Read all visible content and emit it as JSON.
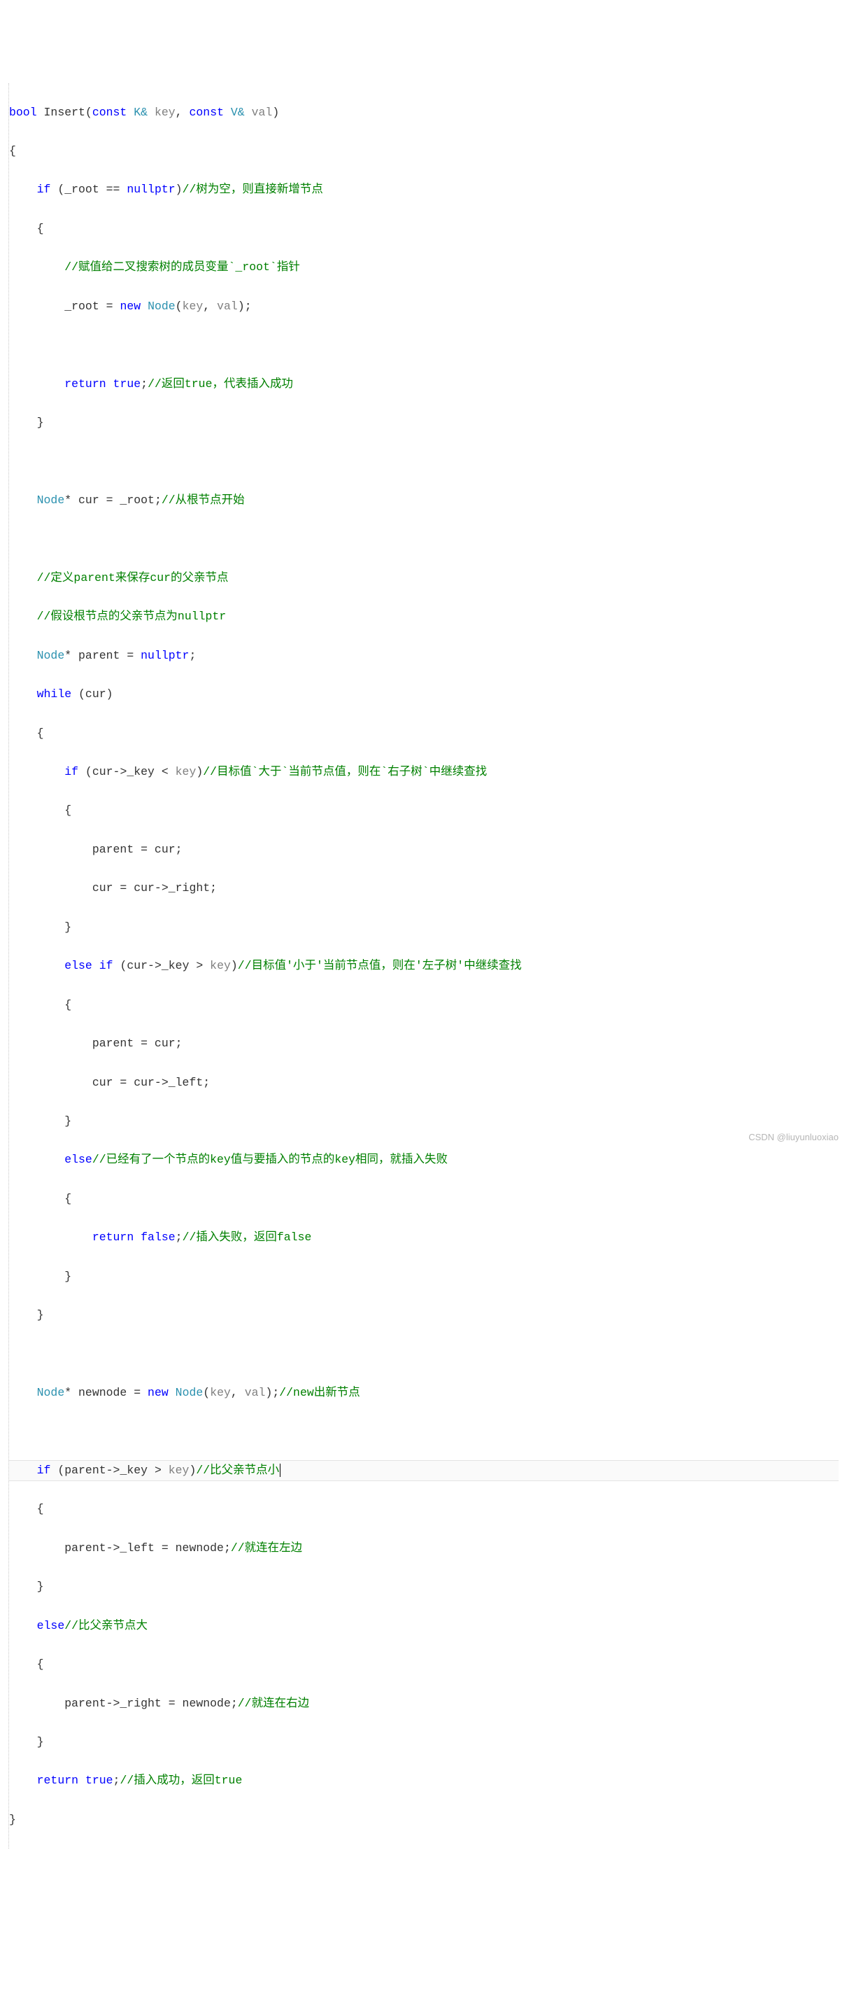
{
  "code": {
    "l01_a": "bool",
    "l01_b": " Insert(",
    "l01_c": "const",
    "l01_d": " K& ",
    "l01_e": "key",
    "l01_f": ", ",
    "l01_g": "const",
    "l01_h": " V& ",
    "l01_i": "val",
    "l01_j": ")",
    "l02": "{",
    "l03_a": "    ",
    "l03_b": "if",
    "l03_c": " (_root == ",
    "l03_d": "nullptr",
    "l03_e": ")",
    "l03_f": "//树为空，则直接新增节点",
    "l04": "    {",
    "l05_a": "        ",
    "l05_b": "//赋值给二叉搜索树的成员变量`_root`指针",
    "l06_a": "        _root = ",
    "l06_b": "new",
    "l06_c": " ",
    "l06_d": "Node",
    "l06_e": "(",
    "l06_f": "key",
    "l06_g": ", ",
    "l06_h": "val",
    "l06_i": ");",
    "l07": "",
    "l08_a": "        ",
    "l08_b": "return",
    "l08_c": " ",
    "l08_d": "true",
    "l08_e": ";",
    "l08_f": "//返回true，代表插入成功",
    "l09": "    }",
    "l10": "",
    "l11_a": "    ",
    "l11_b": "Node",
    "l11_c": "* cur = _root;",
    "l11_d": "//从根节点开始",
    "l12": "",
    "l13_a": "    ",
    "l13_b": "//定义parent来保存cur的父亲节点",
    "l14_a": "    ",
    "l14_b": "//假设根节点的父亲节点为nullptr",
    "l15_a": "    ",
    "l15_b": "Node",
    "l15_c": "* parent = ",
    "l15_d": "nullptr",
    "l15_e": ";",
    "l16_a": "    ",
    "l16_b": "while",
    "l16_c": " (cur)",
    "l17": "    {",
    "l18_a": "        ",
    "l18_b": "if",
    "l18_c": " (cur->_key < ",
    "l18_d": "key",
    "l18_e": ")",
    "l18_f": "//目标值`大于`当前节点值，则在`右子树`中继续查找",
    "l19": "        {",
    "l20": "            parent = cur;",
    "l21": "            cur = cur->_right;",
    "l22": "        }",
    "l23_a": "        ",
    "l23_b": "else",
    "l23_c": " ",
    "l23_d": "if",
    "l23_e": " (cur->_key > ",
    "l23_f": "key",
    "l23_g": ")",
    "l23_h": "//目标值'小于'当前节点值，则在'左子树'中继续查找",
    "l24": "        {",
    "l25": "            parent = cur;",
    "l26": "            cur = cur->_left;",
    "l27": "        }",
    "l28_a": "        ",
    "l28_b": "else",
    "l28_c": "//已经有了一个节点的key值与要插入的节点的key相同，就插入失败",
    "l29": "        {",
    "l30_a": "            ",
    "l30_b": "return",
    "l30_c": " ",
    "l30_d": "false",
    "l30_e": ";",
    "l30_f": "//插入失败，返回false",
    "l31": "        }",
    "l32": "    }",
    "l33": "",
    "l34_a": "    ",
    "l34_b": "Node",
    "l34_c": "* newnode = ",
    "l34_d": "new",
    "l34_e": " ",
    "l34_f": "Node",
    "l34_g": "(",
    "l34_h": "key",
    "l34_i": ", ",
    "l34_j": "val",
    "l34_k": ");",
    "l34_l": "//new出新节点",
    "l35": "",
    "l36_a": "    ",
    "l36_b": "if",
    "l36_c": " (parent->_key > ",
    "l36_d": "key",
    "l36_e": ")",
    "l36_f": "//比父亲节点小",
    "l37": "    {",
    "l38_a": "        parent->_left = newnode;",
    "l38_b": "//就连在左边",
    "l39": "    }",
    "l40_a": "    ",
    "l40_b": "else",
    "l40_c": "//比父亲节点大",
    "l41": "    {",
    "l42_a": "        parent->_right = newnode;",
    "l42_b": "//就连在右边",
    "l43": "    }",
    "l44_a": "    ",
    "l44_b": "return",
    "l44_c": " ",
    "l44_d": "true",
    "l44_e": ";",
    "l44_f": "//插入成功，返回true",
    "l45": "}"
  },
  "watermark": "CSDN @liuyunluoxiao"
}
